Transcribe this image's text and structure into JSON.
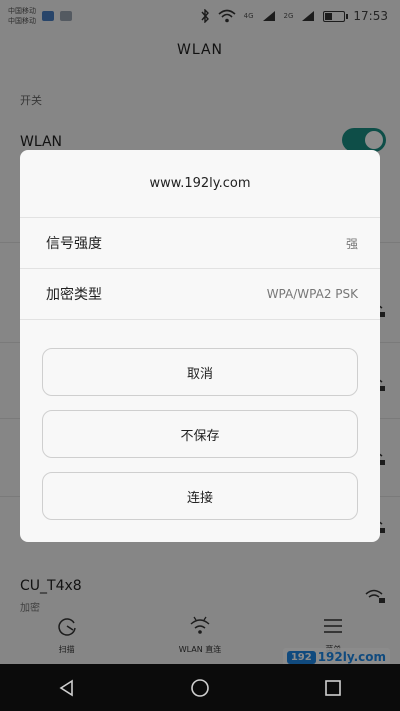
{
  "status_bar": {
    "carriers": [
      "中国移动",
      "中国移动"
    ],
    "net_tags": [
      "4G",
      "2G"
    ],
    "time": "17:53"
  },
  "page": {
    "title": "WLAN",
    "section_switch": "开关",
    "wlan_label": "WLAN",
    "network_bottom": {
      "name": "CU_T4x8",
      "sub": "加密"
    }
  },
  "toolbar": {
    "items": [
      {
        "label": "扫描",
        "icon": "refresh-icon"
      },
      {
        "label": "WLAN 直连",
        "icon": "wifi-direct-icon"
      },
      {
        "label": "菜单",
        "icon": "menu-icon"
      }
    ]
  },
  "dialog": {
    "title": "www.192ly.com",
    "rows": [
      {
        "key": "信号强度",
        "value": "强"
      },
      {
        "key": "加密类型",
        "value": "WPA/WPA2 PSK"
      }
    ],
    "buttons": {
      "cancel": "取消",
      "forget": "不保存",
      "connect": "连接"
    }
  },
  "watermark": {
    "badge": "192",
    "text": "192ly.com"
  },
  "colors": {
    "toggle_on": "#1a8f84",
    "overlay": "rgba(0,0,0,0.45)",
    "watermark": "#1e88e5"
  }
}
